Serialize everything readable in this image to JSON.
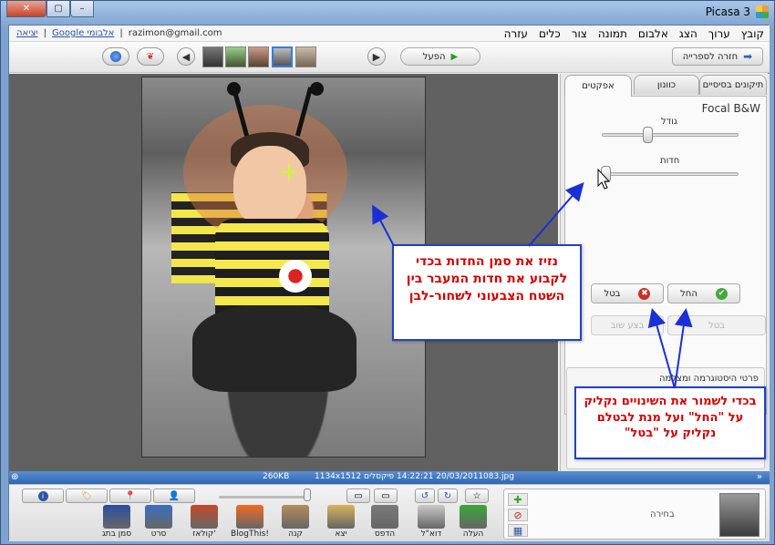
{
  "window": {
    "title": "Picasa 3",
    "close_glyph": "✕",
    "min_glyph": "–",
    "max_glyph": "▢"
  },
  "menu": {
    "items": [
      "קובץ",
      "ערוך",
      "הצג",
      "אלבום",
      "תמונה",
      "צור",
      "כלים",
      "עזרה"
    ]
  },
  "account": {
    "exit": "יציאה",
    "google_albums": "Google אלבומי",
    "email": "razimon@gmail.com"
  },
  "toolbar": {
    "back_label": "חזרה לספרייה",
    "play_label": "הפעל"
  },
  "tabs": {
    "basic": "תיקונים בסיסיים",
    "tuning": "כוונון",
    "effects": "אפקטים"
  },
  "effect": {
    "name": "Focal B&W",
    "size_label": "גודל",
    "sharpness_label": "חדות",
    "size_value": 0.33,
    "sharpness_value": 0.0
  },
  "actions": {
    "apply": "החל",
    "cancel": "בטל",
    "undo_disabled": "בטל",
    "redo_disabled": "בצע שוב"
  },
  "histogram": {
    "title": "פרטי היסטוגרמה ומצלמה"
  },
  "status": {
    "filename": "083.jpg",
    "datetime": "14:22:21 20/03/2011",
    "dimensions": "1134x1512 פיקסלים",
    "filesize": "260KB"
  },
  "bottom_tools": [
    {
      "label": "העלה",
      "icon": "upload-icon",
      "color": "#3aa63a"
    },
    {
      "label": "דוא\"ל",
      "icon": "email-icon",
      "color": "#c9c9c9"
    },
    {
      "label": "הדפס",
      "icon": "print-icon",
      "color": "#7a7a7a"
    },
    {
      "label": "יצא",
      "icon": "export-folder-icon",
      "color": "#d8b35a"
    },
    {
      "label": "קנה",
      "icon": "shop-icon",
      "color": "#b58b5b"
    },
    {
      "label": "BlogThis!",
      "icon": "blogger-icon",
      "color": "#f26a22"
    },
    {
      "label": "קולאז'",
      "icon": "collage-icon",
      "color": "#c44a2a"
    },
    {
      "label": "סרט",
      "icon": "movie-icon",
      "color": "#3a6fbf"
    },
    {
      "label": "סמן בתג",
      "icon": "geotag-icon",
      "color": "#2a4fa0"
    }
  ],
  "tray": {
    "selection_label": "בחירה"
  },
  "callouts": {
    "drag_hint": "נזיז את סמן החדות בכדי לקבוע את חדות המעבר בין השטח הצבעוני לשחור-לבן",
    "save_hint": "בכדי לשמור את השינויים נקליק על \"החל\" ועל מנת לבטלם נקליק על \"בטל\""
  },
  "colors": {
    "callout_text": "#d00000",
    "callout_border": "#2141c4",
    "arrow": "#1a2fd6",
    "status_bar": "#2d66b2"
  }
}
